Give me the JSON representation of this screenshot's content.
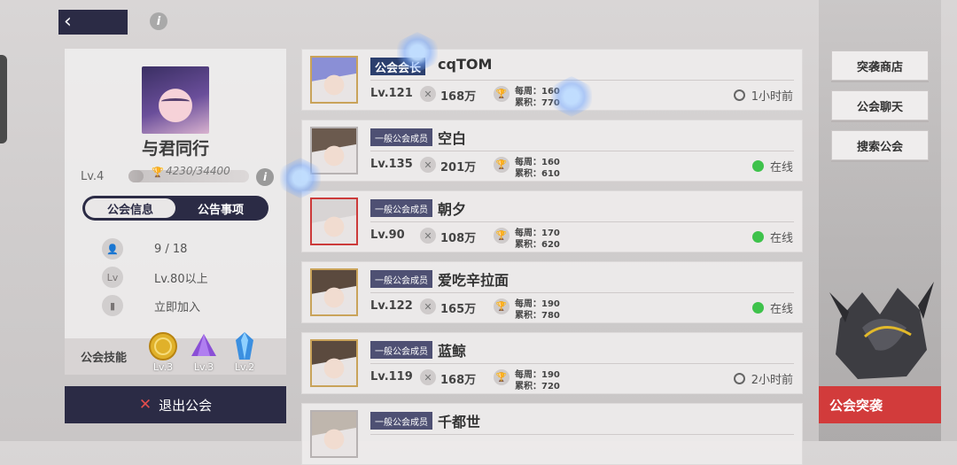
{
  "header": {
    "back_icon": "chevron-left-icon",
    "info_icon_glyph": "i"
  },
  "guild": {
    "name": "与君同行",
    "level": "Lv.4",
    "exp": "4230/34400",
    "exp_fraction": 0.123,
    "tabs": [
      "公会信息",
      "公告事项"
    ],
    "info": {
      "members": "9 / 18",
      "requirement_icon": "Lv",
      "requirement": "Lv.80以上",
      "join": "立即加入"
    },
    "skills_label": "公会技能",
    "skills": [
      {
        "name": "coin",
        "level": "Lv.3",
        "color": "#e0b12a"
      },
      {
        "name": "purple-crystal",
        "level": "Lv.3",
        "color": "#8a4fd6"
      },
      {
        "name": "blue-crystal",
        "level": "Lv.2",
        "color": "#3b8fe0"
      }
    ],
    "quit_label": "退出公会"
  },
  "members": [
    {
      "role": "公会会长",
      "name": "cqTOM",
      "level": "Lv.121",
      "power": "168万",
      "weekly": "每周：160",
      "total": "累积：770",
      "status": "1小时前",
      "online": false,
      "leader": true,
      "frame": "gold",
      "avatar_color": "#8a8fd6"
    },
    {
      "role": "一般公会成员",
      "name": "空白",
      "level": "Lv.135",
      "power": "201万",
      "weekly": "每周：160",
      "total": "累积：610",
      "status": "在线",
      "online": true,
      "leader": false,
      "frame": "plain",
      "avatar_color": "#6b5a4e"
    },
    {
      "role": "一般公会成员",
      "name": "朝夕",
      "level": "Lv.90",
      "power": "108万",
      "weekly": "每周：170",
      "total": "累积：620",
      "status": "在线",
      "online": true,
      "leader": false,
      "frame": "red",
      "avatar_color": "#d8d4d4"
    },
    {
      "role": "一般公会成员",
      "name": "爱吃辛拉面",
      "level": "Lv.122",
      "power": "165万",
      "weekly": "每周：190",
      "total": "累积：780",
      "status": "在线",
      "online": true,
      "leader": false,
      "frame": "gold",
      "avatar_color": "#5b4a3e"
    },
    {
      "role": "一般公会成员",
      "name": "蓝鲸",
      "level": "Lv.119",
      "power": "168万",
      "weekly": "每周：190",
      "total": "累积：720",
      "status": "2小时前",
      "online": false,
      "leader": false,
      "frame": "gold",
      "avatar_color": "#5b4a3e"
    },
    {
      "role": "一般公会成员",
      "name": "千都世",
      "level": "",
      "power": "",
      "weekly": "",
      "total": "",
      "status": "",
      "online": false,
      "leader": false,
      "frame": "plain",
      "avatar_color": "#bfb6ad"
    }
  ],
  "right": {
    "shop": "突袭商店",
    "chat": "公会聊天",
    "search": "搜索公会",
    "raid": "公会突袭"
  },
  "colors": {
    "navy": "#2b2b45",
    "raid_red": "#d23b3b",
    "online_green": "#3ec24b"
  }
}
